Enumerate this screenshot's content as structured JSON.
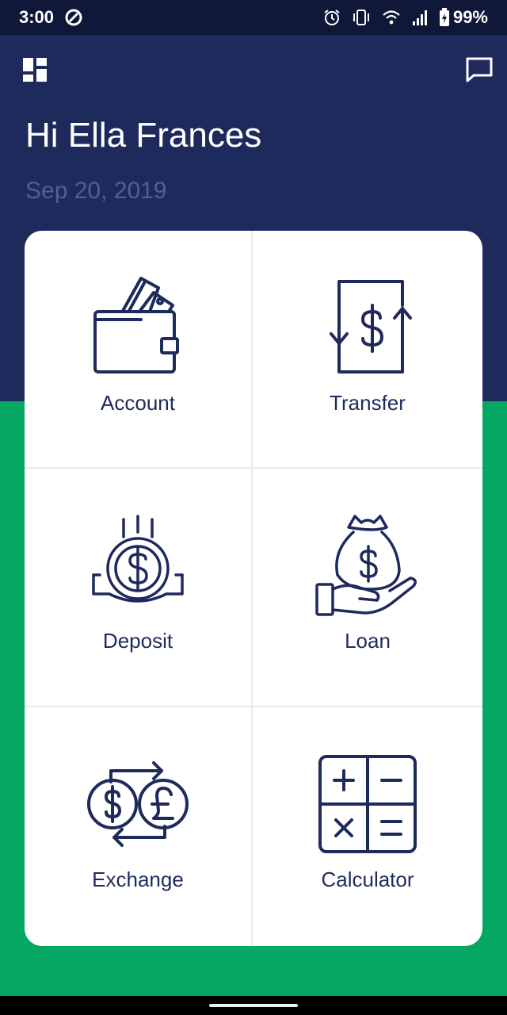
{
  "status_bar": {
    "time": "3:00",
    "battery": "99%",
    "icons": [
      "data-saver-icon",
      "alarm-icon",
      "vibrate-icon",
      "wifi-icon",
      "signal-icon",
      "battery-charging-icon"
    ]
  },
  "header": {
    "menu_icon": "dashboard-icon",
    "chat_icon": "chat-bubble-icon",
    "greeting": "Hi Ella Frances",
    "date": "Sep 20, 2019"
  },
  "menu": {
    "items": [
      {
        "label": "Account",
        "icon": "wallet-icon"
      },
      {
        "label": "Transfer",
        "icon": "transfer-icon"
      },
      {
        "label": "Deposit",
        "icon": "deposit-icon"
      },
      {
        "label": "Loan",
        "icon": "loan-icon"
      },
      {
        "label": "Exchange",
        "icon": "exchange-icon"
      },
      {
        "label": "Calculator",
        "icon": "calculator-icon"
      }
    ]
  },
  "colors": {
    "header_bg": "#1e2a5c",
    "status_bg": "#0f1839",
    "accent_green": "#05a862",
    "icon_navy": "#1e2a5c",
    "date_text": "#4f5f97"
  }
}
